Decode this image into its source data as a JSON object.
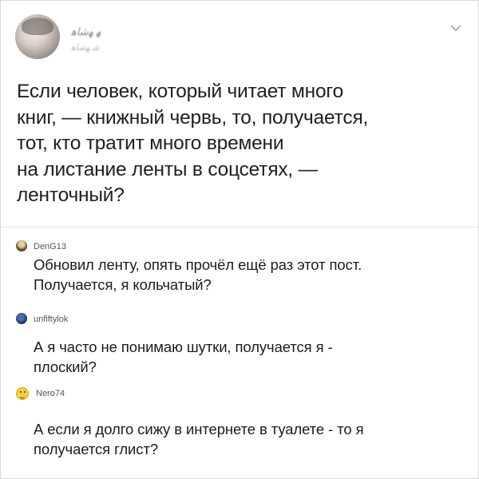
{
  "post": {
    "author_name": "ﻬ ﻬﺷﺎﻫ",
    "author_handle": "ﺷ ﻬﺷﺎﻫ",
    "menu_icon": "chevron-down-icon",
    "text_lines": [
      "Если человек, который читает много",
      "книг, — книжный червь, то, получается,",
      "тот, кто тратит много времени",
      "на листание ленты в соцсетях, —",
      "ленточный?"
    ]
  },
  "comments": [
    {
      "user": "DenG13",
      "avatar_icon": "user-avatar-icon",
      "text_lines": [
        "Обновил ленту, опять прочёл ещё раз этот пост.",
        "Получается, я кольчатый?"
      ]
    },
    {
      "user": "unfiftylok",
      "avatar_icon": "user-avatar-icon",
      "text_lines": [
        "А я часто не понимаю шутки, получается я -",
        "плоский?"
      ]
    },
    {
      "user": "Nero74",
      "avatar_icon": "smiley-face-icon",
      "text_lines": [
        "А если я долго сижу в интернете в туалете - то я",
        "получается глист?"
      ]
    }
  ],
  "colors": {
    "background": "#ffffff",
    "text": "#202020",
    "muted": "#8a8a8a",
    "divider": "#e6e6e6"
  }
}
